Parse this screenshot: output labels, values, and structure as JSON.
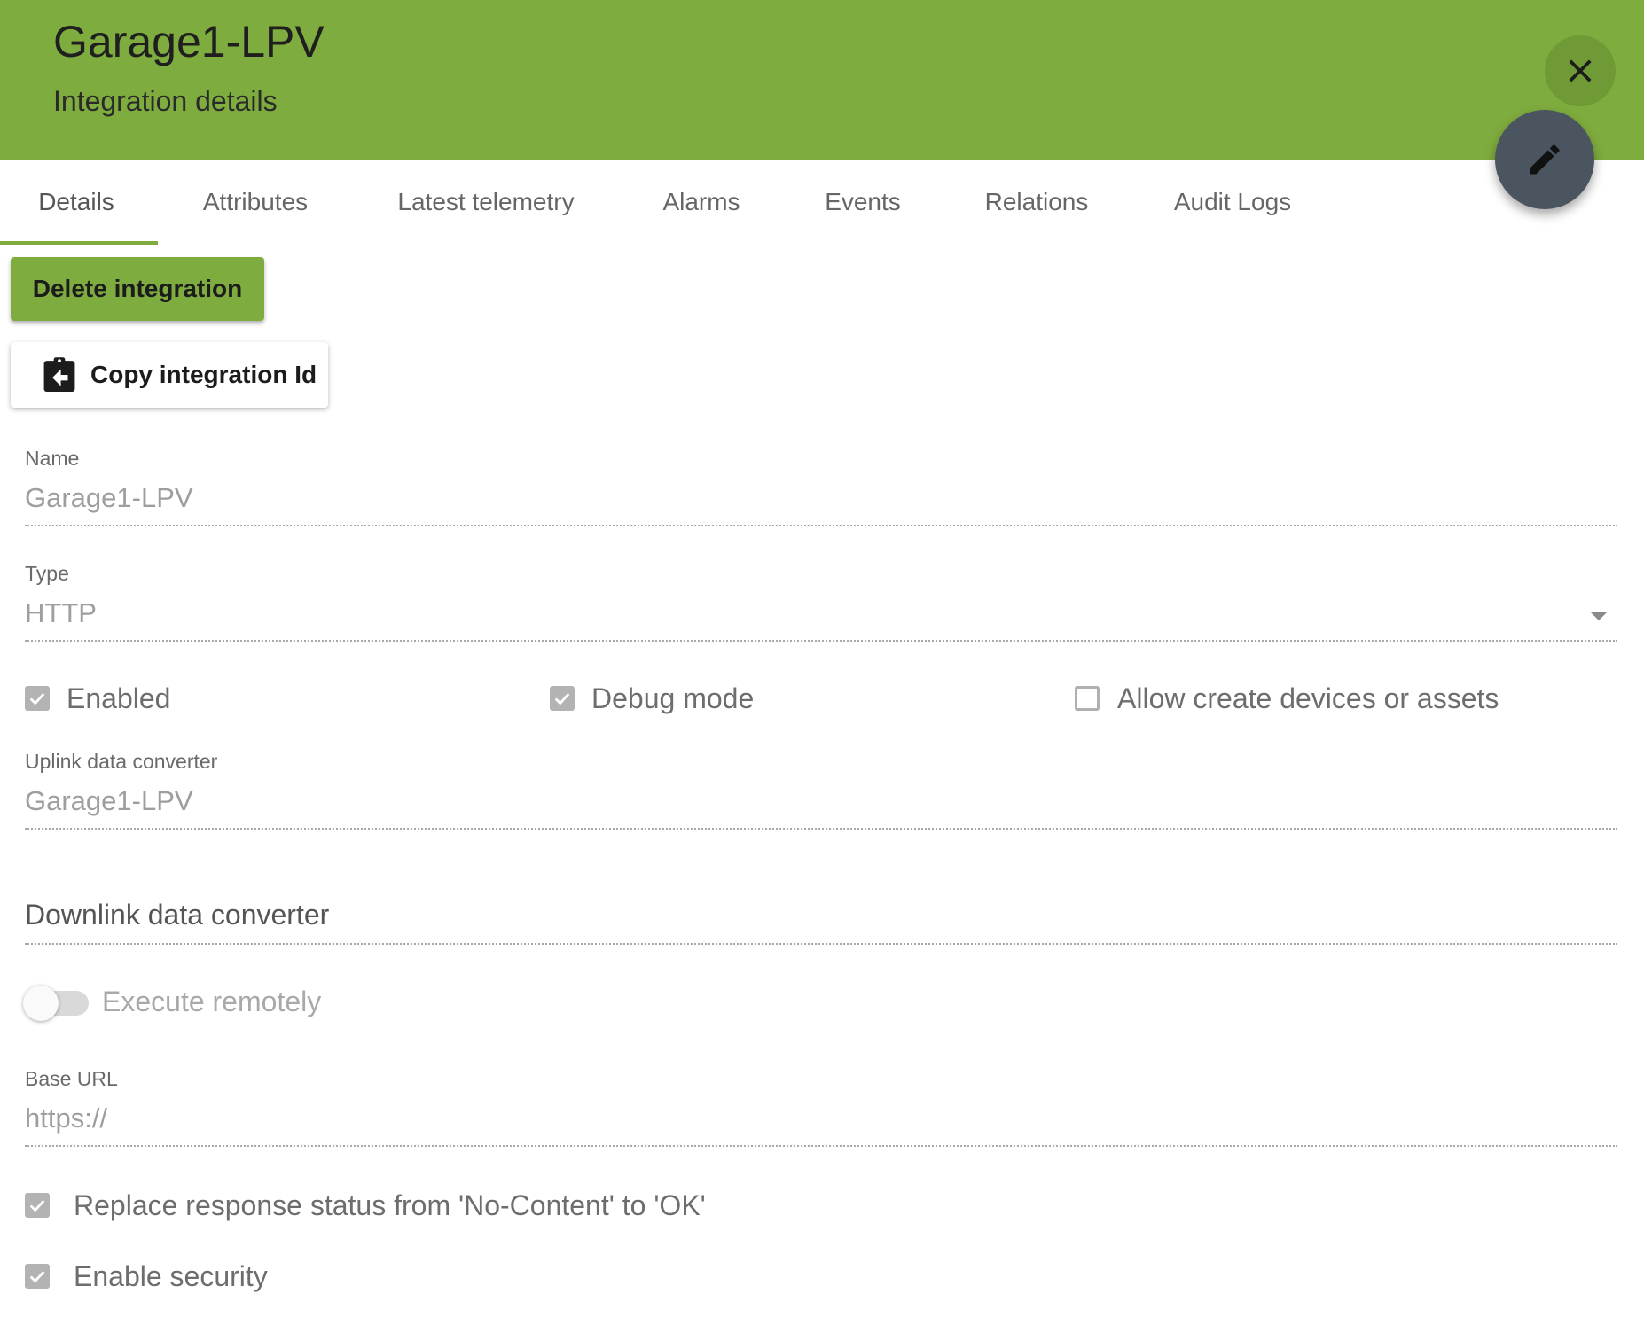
{
  "header": {
    "title": "Garage1-LPV",
    "subtitle": "Integration details",
    "close_icon": "close-icon",
    "edit_icon": "pencil-icon",
    "color": "#7fac3e"
  },
  "tabs": [
    {
      "label": "Details",
      "active": true
    },
    {
      "label": "Attributes"
    },
    {
      "label": "Latest telemetry"
    },
    {
      "label": "Alarms"
    },
    {
      "label": "Events"
    },
    {
      "label": "Relations"
    },
    {
      "label": "Audit Logs"
    }
  ],
  "actions": {
    "delete_label": "Delete integration",
    "copy_label": "Copy integration Id",
    "copy_icon": "clipboard-arrow-icon"
  },
  "form": {
    "name": {
      "label": "Name",
      "value": "Garage1-LPV"
    },
    "type": {
      "label": "Type",
      "value": "HTTP"
    },
    "enabled": {
      "label": "Enabled",
      "checked": true
    },
    "debug_mode": {
      "label": "Debug mode",
      "checked": true
    },
    "allow_create": {
      "label": "Allow create devices or assets",
      "checked": false
    },
    "uplink": {
      "label": "Uplink data converter",
      "value": "Garage1-LPV"
    },
    "downlink": {
      "label": "Downlink data converter",
      "value": ""
    },
    "execute_remotely": {
      "label": "Execute remotely",
      "on": false
    },
    "base_url": {
      "label": "Base URL",
      "value": "https://"
    },
    "replace_status": {
      "label": "Replace response status from 'No-Content' to 'OK'",
      "checked": true
    },
    "enable_security": {
      "label": "Enable security",
      "checked": true
    }
  }
}
